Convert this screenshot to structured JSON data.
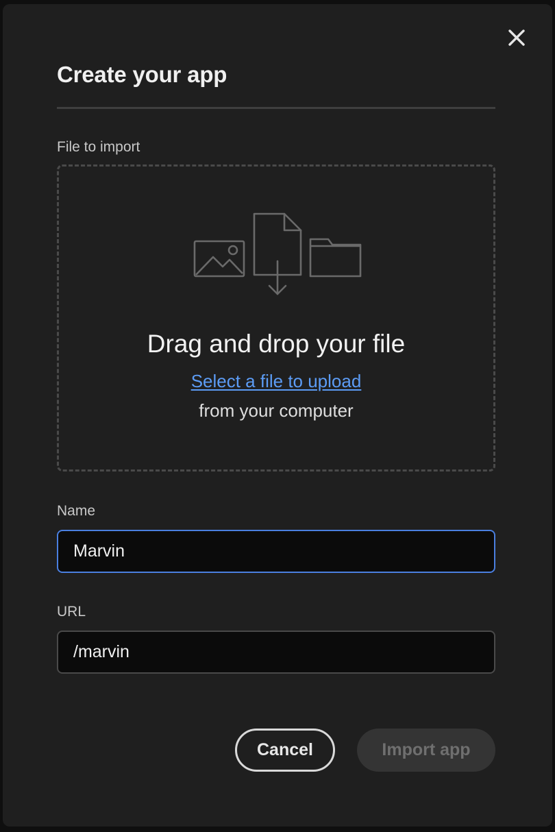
{
  "dialog": {
    "title": "Create your app",
    "close_icon": "close-icon"
  },
  "file_import": {
    "label": "File to import",
    "illustration_icons": [
      "image-icon",
      "file-download-icon",
      "folder-icon"
    ],
    "heading": "Drag and drop your file",
    "link_text": "Select a file to upload",
    "subtext": "from your computer"
  },
  "name_field": {
    "label": "Name",
    "value": "Marvin",
    "focused": true
  },
  "url_field": {
    "label": "URL",
    "value": "/marvin"
  },
  "actions": {
    "cancel_label": "Cancel",
    "import_label": "Import app",
    "import_disabled": true
  },
  "colors": {
    "background": "#1f1f1f",
    "accent_link": "#5c9cf5",
    "focus_border": "#4a7fe0",
    "input_background": "#0b0b0b"
  }
}
